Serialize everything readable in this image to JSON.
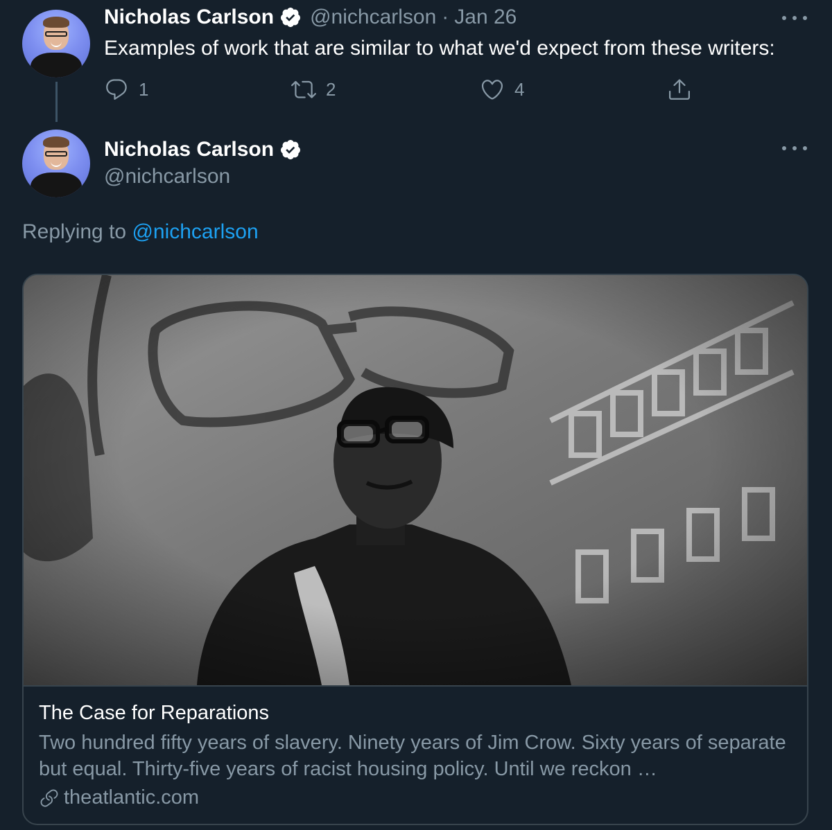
{
  "colors": {
    "background": "#15202b",
    "primary_text": "#ffffff",
    "secondary_text": "#8899a6",
    "link": "#1da1f2",
    "border": "#38444d"
  },
  "tweet1": {
    "author_name": "Nicholas Carlson",
    "handle": "@nichcarlson",
    "separator": "·",
    "date": "Jan 26",
    "text": "Examples of work that are similar to what we'd expect from these writers:",
    "actions": {
      "reply": {
        "icon": "reply-icon",
        "count": "1"
      },
      "retweet": {
        "icon": "retweet-icon",
        "count": "2"
      },
      "like": {
        "icon": "heart-icon",
        "count": "4"
      },
      "share": {
        "icon": "share-icon"
      }
    }
  },
  "tweet2": {
    "author_name": "Nicholas Carlson",
    "handle": "@nichcarlson",
    "replying_prefix": "Replying to",
    "replying_to": "@nichcarlson",
    "card": {
      "title": "The Case for Reparations",
      "description": "Two hundred fifty years of slavery. Ninety years of Jim Crow. Sixty years of separate but equal. Thirty-five years of racist housing policy. Until we reckon …",
      "domain": "theatlantic.com"
    }
  }
}
